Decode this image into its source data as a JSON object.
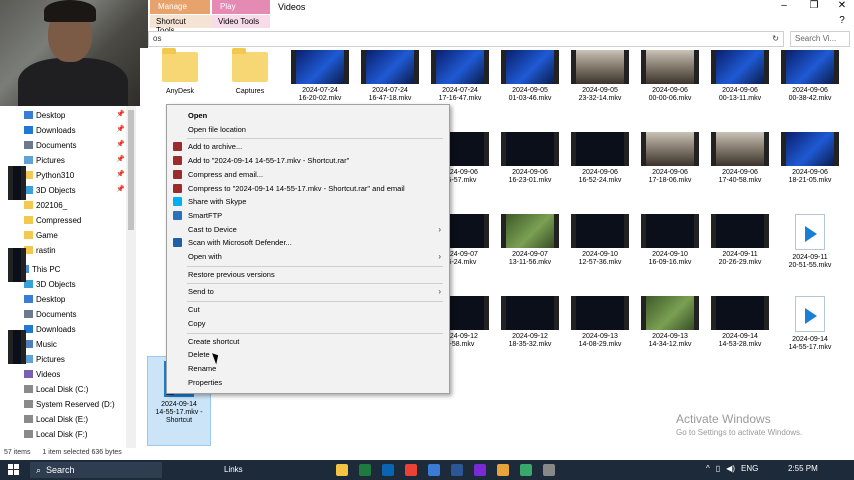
{
  "ribbon": {
    "manage_tab": "Manage",
    "play_tab": "Play",
    "videos_tab": "Videos",
    "shortcut_tools": "Shortcut Tools",
    "video_tools": "Video Tools",
    "address_text": "os",
    "search_placeholder": "Search Vi...",
    "minimize": "–",
    "restore": "❐",
    "close": "✕",
    "help": "?"
  },
  "nav": {
    "quick_access": [
      {
        "label": "Desktop",
        "color": "#3a7bd5",
        "pinned": true
      },
      {
        "label": "Downloads",
        "color": "#1f78d1",
        "pinned": true
      },
      {
        "label": "Documents",
        "color": "#6b7a8f",
        "pinned": true
      },
      {
        "label": "Pictures",
        "color": "#5fa3d6",
        "pinned": true
      },
      {
        "label": "Python310",
        "color": "#f2c84f",
        "pinned": true
      },
      {
        "label": "3D Objects",
        "color": "#3aa0d8",
        "pinned": true
      },
      {
        "label": "202106_",
        "color": "#f2c84f",
        "pinned": false
      },
      {
        "label": "Compressed",
        "color": "#f2c84f",
        "pinned": false
      },
      {
        "label": "Game",
        "color": "#f2c84f",
        "pinned": false
      },
      {
        "label": "rastin",
        "color": "#f2c84f",
        "pinned": false
      }
    ],
    "this_pc": "This PC",
    "pc_items": [
      {
        "label": "3D Objects",
        "color": "#3aa0d8"
      },
      {
        "label": "Desktop",
        "color": "#3a7bd5"
      },
      {
        "label": "Documents",
        "color": "#6b7a8f"
      },
      {
        "label": "Downloads",
        "color": "#1f78d1"
      },
      {
        "label": "Music",
        "color": "#4e7fb8"
      },
      {
        "label": "Pictures",
        "color": "#5fa3d6"
      },
      {
        "label": "Videos",
        "color": "#7a5fb5"
      },
      {
        "label": "Local Disk (C:)",
        "color": "#8a8a8a"
      },
      {
        "label": "System Reserved (D:)",
        "color": "#8a8a8a"
      },
      {
        "label": "Local Disk (E:)",
        "color": "#8a8a8a"
      },
      {
        "label": "Local Disk (F:)",
        "color": "#8a8a8a"
      }
    ]
  },
  "tiles": [
    {
      "kind": "folder",
      "l1": "AnyDesk",
      "l2": "",
      "thumb": ""
    },
    {
      "kind": "folder",
      "l1": "Captures",
      "l2": "",
      "thumb": ""
    },
    {
      "kind": "video",
      "l1": "2024-07-24",
      "l2": "16-20-02.mkv",
      "thumb": "blue"
    },
    {
      "kind": "video",
      "l1": "2024-07-24",
      "l2": "16-47-18.mkv",
      "thumb": "blue"
    },
    {
      "kind": "video",
      "l1": "2024-07-24",
      "l2": "17-16-47.mkv",
      "thumb": "blue"
    },
    {
      "kind": "video",
      "l1": "2024-09-05",
      "l2": "01-03-46.mkv",
      "thumb": "blue"
    },
    {
      "kind": "video",
      "l1": "2024-09-05",
      "l2": "23-32-14.mkv",
      "thumb": "person"
    },
    {
      "kind": "video",
      "l1": "2024-09-06",
      "l2": "00-00-06.mkv",
      "thumb": "person"
    },
    {
      "kind": "video",
      "l1": "2024-09-06",
      "l2": "00-13-11.mkv",
      "thumb": "blue"
    },
    {
      "kind": "video",
      "l1": "2024-09-06",
      "l2": "00-38-42.mkv",
      "thumb": "blue"
    },
    {
      "kind": "video",
      "l1": "2024-09-06",
      "l2": "15-57.mkv",
      "thumb": "dark"
    },
    {
      "kind": "video",
      "l1": "2024-09-06",
      "l2": "16-23-01.mkv",
      "thumb": "dark"
    },
    {
      "kind": "video",
      "l1": "2024-09-06",
      "l2": "16-52-24.mkv",
      "thumb": "dark"
    },
    {
      "kind": "video",
      "l1": "2024-09-06",
      "l2": "17-18-06.mkv",
      "thumb": "person"
    },
    {
      "kind": "video",
      "l1": "2024-09-06",
      "l2": "17-40-58.mkv",
      "thumb": "person"
    },
    {
      "kind": "video",
      "l1": "2024-09-06",
      "l2": "18-21-05.mkv",
      "thumb": "blue"
    },
    {
      "kind": "video",
      "l1": "2024-09-07",
      "l2": "26-24.mkv",
      "thumb": "dark"
    },
    {
      "kind": "video",
      "l1": "2024-09-07",
      "l2": "13-11-56.mkv",
      "thumb": "green"
    },
    {
      "kind": "video",
      "l1": "2024-09-10",
      "l2": "12-57-36.mkv",
      "thumb": "dark"
    },
    {
      "kind": "video",
      "l1": "2024-09-10",
      "l2": "16-09-16.mkv",
      "thumb": "dark"
    },
    {
      "kind": "video",
      "l1": "2024-09-11",
      "l2": "20-26-29.mkv",
      "thumb": "dark"
    },
    {
      "kind": "file",
      "l1": "2024-09-11",
      "l2": "20-51-55.mkv",
      "thumb": ""
    },
    {
      "kind": "video",
      "l1": "2024-09-12",
      "l2": "4-58.mkv",
      "thumb": "dark"
    },
    {
      "kind": "video",
      "l1": "2024-09-12",
      "l2": "18-35-32.mkv",
      "thumb": "dark"
    },
    {
      "kind": "video",
      "l1": "2024-09-13",
      "l2": "14-08-29.mkv",
      "thumb": "dark"
    },
    {
      "kind": "video",
      "l1": "2024-09-13",
      "l2": "14-34-12.mkv",
      "thumb": "green"
    },
    {
      "kind": "video",
      "l1": "2024-09-14",
      "l2": "14-53-28.mkv",
      "thumb": "dark"
    },
    {
      "kind": "file",
      "l1": "2024-09-14",
      "l2": "14-55-17.mkv",
      "thumb": ""
    }
  ],
  "selected_tile": {
    "l1": "2024-09-14",
    "l2": "14-55-17.mkv -",
    "l3": "Shortcut"
  },
  "context_menu": {
    "items": [
      {
        "label": "Open",
        "icon": "",
        "bold": true,
        "arrow": false
      },
      {
        "label": "Open file location",
        "icon": "",
        "bold": false,
        "arrow": false
      },
      {
        "label": "Add to archive...",
        "icon": "#9b2c2c",
        "bold": false,
        "arrow": false
      },
      {
        "label": "Add to \"2024-09-14 14-55-17.mkv - Shortcut.rar\"",
        "icon": "#9b2c2c",
        "bold": false,
        "arrow": false
      },
      {
        "label": "Compress and email...",
        "icon": "#9b2c2c",
        "bold": false,
        "arrow": false
      },
      {
        "label": "Compress to \"2024-09-14 14-55-17.mkv - Shortcut.rar\" and email",
        "icon": "#9b2c2c",
        "bold": false,
        "arrow": false
      },
      {
        "label": "Share with Skype",
        "icon": "#00aff0",
        "bold": false,
        "arrow": false
      },
      {
        "label": "SmartFTP",
        "icon": "#2d6fb8",
        "bold": false,
        "arrow": false
      },
      {
        "label": "Cast to Device",
        "icon": "",
        "bold": false,
        "arrow": true
      },
      {
        "label": "Scan with Microsoft Defender...",
        "icon": "#1f5fa8",
        "bold": false,
        "arrow": false
      },
      {
        "label": "Open with",
        "icon": "",
        "bold": false,
        "arrow": true
      },
      {
        "label": "Restore previous versions",
        "icon": "",
        "bold": false,
        "arrow": false
      },
      {
        "label": "Send to",
        "icon": "",
        "bold": false,
        "arrow": true
      },
      {
        "label": "Cut",
        "icon": "",
        "bold": false,
        "arrow": false
      },
      {
        "label": "Copy",
        "icon": "",
        "bold": false,
        "arrow": false
      },
      {
        "label": "Create shortcut",
        "icon": "",
        "bold": false,
        "arrow": false
      },
      {
        "label": "Delete",
        "icon": "",
        "bold": false,
        "arrow": false
      },
      {
        "label": "Rename",
        "icon": "",
        "bold": false,
        "arrow": false
      },
      {
        "label": "Properties",
        "icon": "",
        "bold": false,
        "arrow": false
      }
    ]
  },
  "status": {
    "count": "57 items",
    "selection": "1 item selected  636 bytes"
  },
  "watermark": {
    "title": "Activate Windows",
    "subtitle": "Go to Settings to activate Windows."
  },
  "taskbar": {
    "search_label": "Search",
    "links_label": "Links",
    "pinned_colors": [
      "#f4c542",
      "#1f7a3f",
      "#0a64b4",
      "#ea4335",
      "#3a7bd5",
      "#2b5797",
      "#7a2bd5",
      "#e8a33a",
      "#38a86b",
      "#888888"
    ],
    "time": "2:55 PM",
    "tray_language": "ENG"
  },
  "colors": {
    "taskbar_bg": "#1c2a3a",
    "selection_bg": "#cce4f7",
    "menu_bg": "#f2f2f2"
  }
}
